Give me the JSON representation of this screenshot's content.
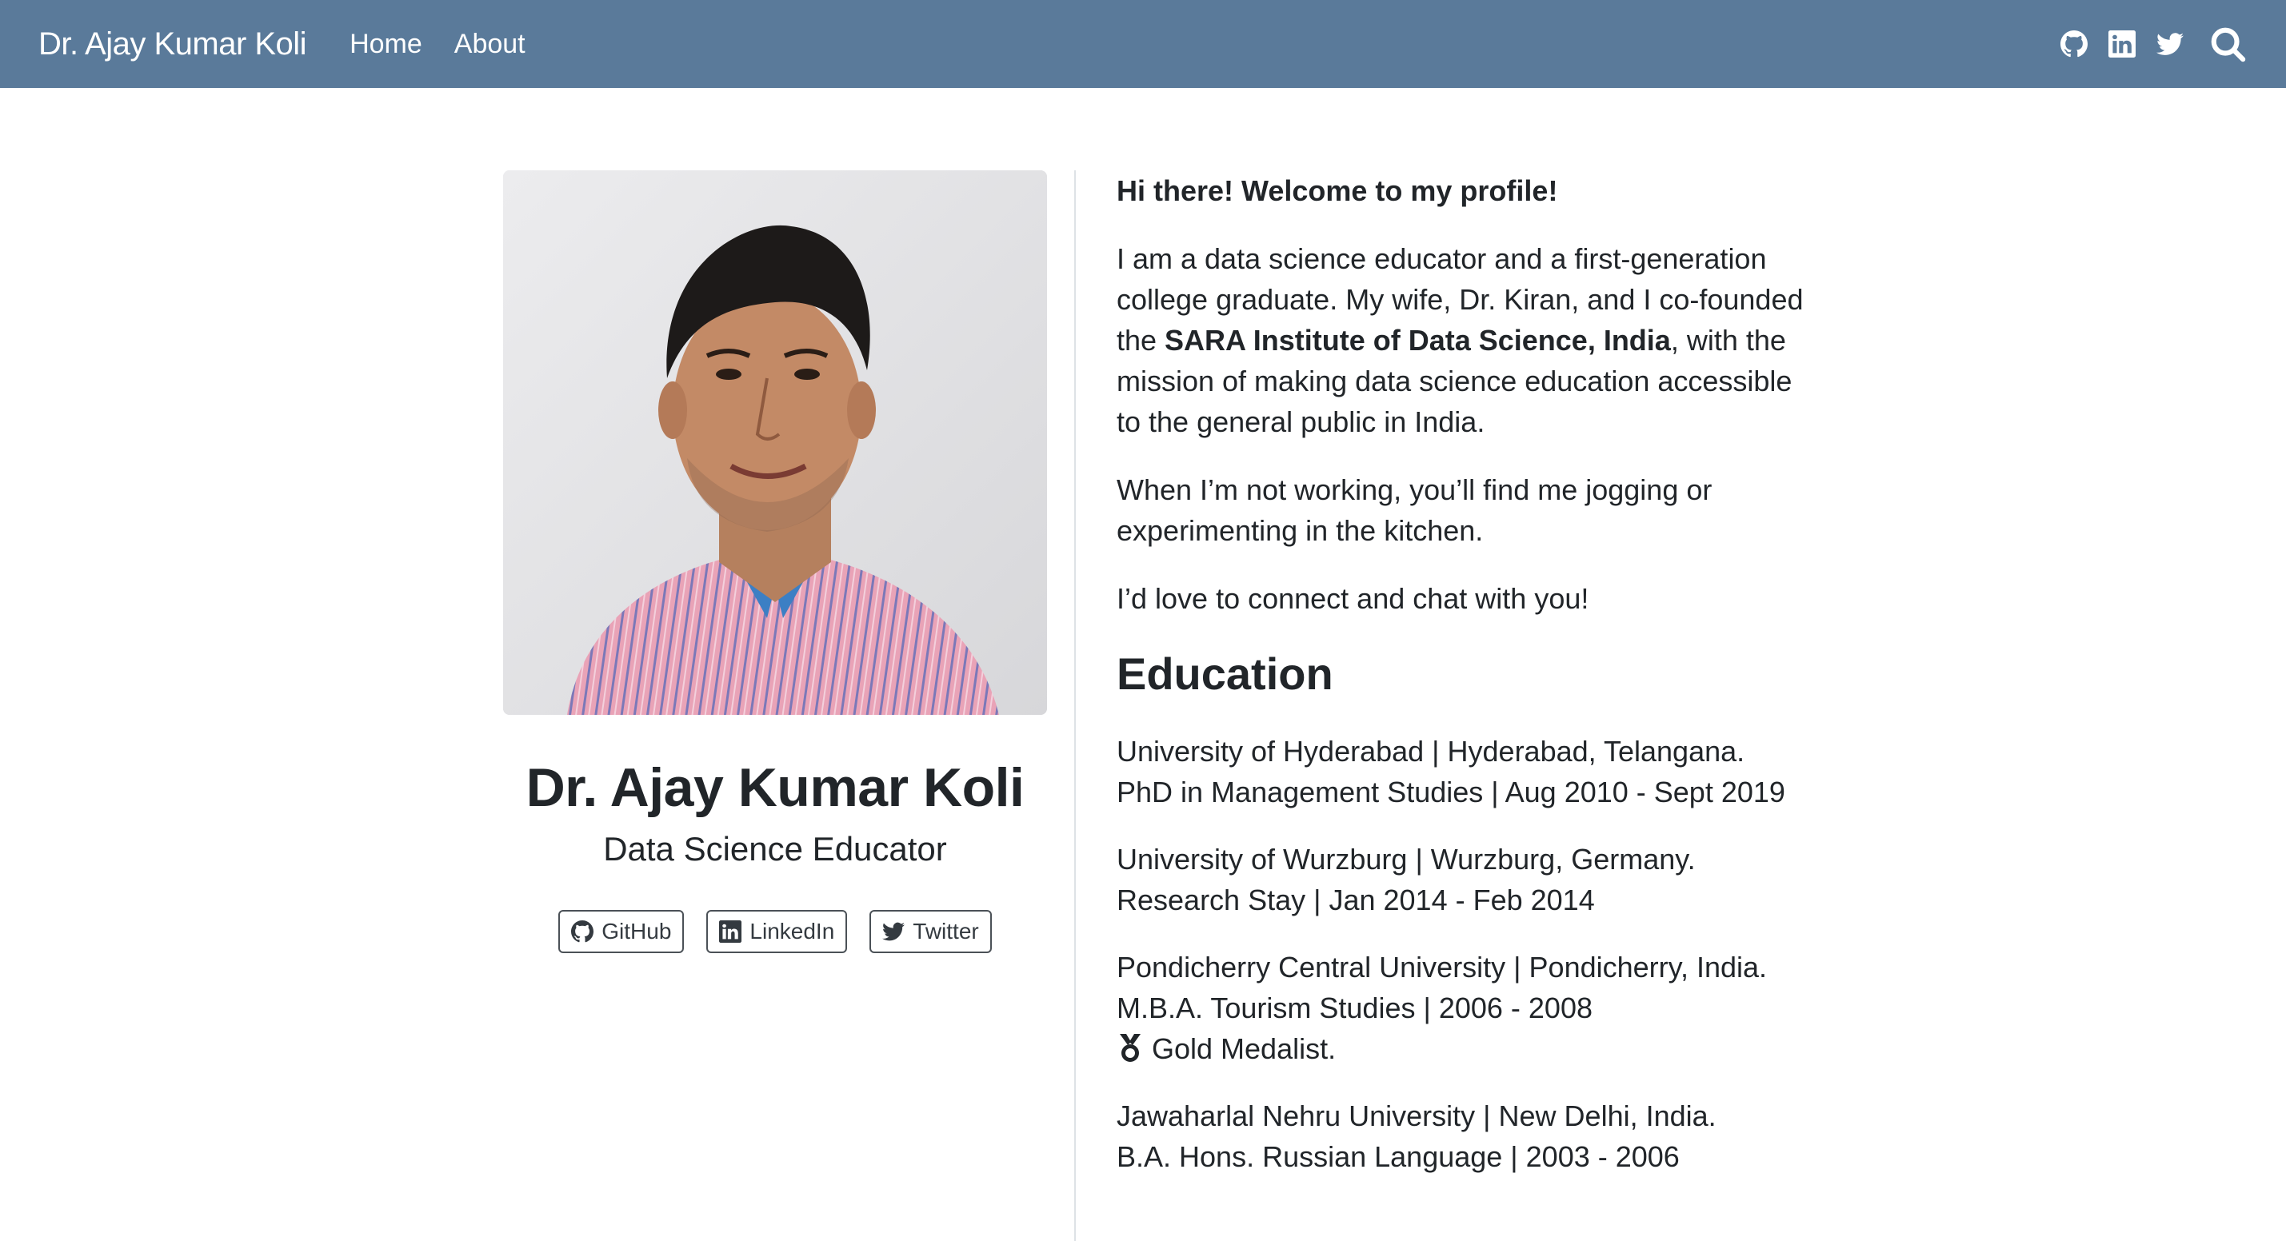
{
  "nav": {
    "brand": "Dr. Ajay Kumar Koli",
    "links": [
      "Home",
      "About"
    ],
    "icons": [
      "github-icon",
      "linkedin-icon",
      "twitter-icon",
      "search-icon"
    ],
    "background": "#5a7a9a"
  },
  "profile": {
    "name": "Dr. Ajay Kumar Koli",
    "title": "Data Science Educator",
    "buttons": [
      "GitHub",
      "LinkedIn",
      "Twitter"
    ]
  },
  "about": {
    "greeting": "Hi there! Welcome to my profile!",
    "intro_before": "I am a data science educator and a first-generation college graduate. My wife, Dr. Kiran, and I co-founded the ",
    "intro_bold": "SARA Institute of Data Science, India",
    "intro_after": ", with the mission of making data science education accessible to the general public in India.",
    "hobbies": "When I’m not working, you’ll find me jogging or experimenting in the kitchen.",
    "connect": "I’d love to connect and chat with you!"
  },
  "education": {
    "heading": "Education",
    "entries": [
      {
        "line1": "University of Hyderabad | Hyderabad, Telangana.",
        "line2": "PhD in Management Studies | Aug 2010 - Sept 2019"
      },
      {
        "line1": "University of Wurzburg | Wurzburg, Germany.",
        "line2": "Research Stay | Jan 2014 - Feb 2014"
      },
      {
        "line1": "Pondicherry Central University | Pondicherry, India.",
        "line2": "M.B.A. Tourism Studies | 2006 - 2008",
        "line3": "Gold Medalist."
      },
      {
        "line1": "Jawaharlal Nehru University | New Delhi, India.",
        "line2": "B.A. Hons. Russian Language | 2003 - 2006"
      }
    ]
  }
}
